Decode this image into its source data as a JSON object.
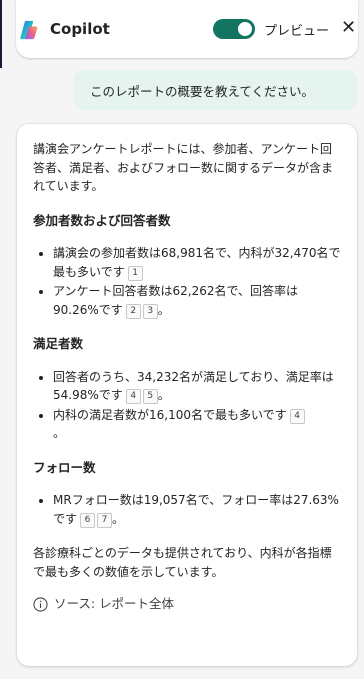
{
  "header": {
    "app_title": "Copilot",
    "toggle_label": "プレビュー",
    "toggle_on": true,
    "close_glyph": "✕",
    "accent_color": "#137462"
  },
  "user_message": "このレポートの概要を教えてください。",
  "response": {
    "intro": "講演会アンケートレポートには、参加者、アンケート回答者、満足者、およびフォロー数に関するデータが含まれています。",
    "sections": [
      {
        "heading": "参加者数および回答者数",
        "items": [
          {
            "text": "講演会の参加者数は68,981名で、内科が32,470名で最も多いです",
            "citations": [
              "1"
            ]
          },
          {
            "text": "アンケート回答者数は62,262名で、回答率は90.26%です",
            "citations": [
              "2",
              "3"
            ],
            "suffix": "。"
          }
        ]
      },
      {
        "heading": "満足者数",
        "items": [
          {
            "text": "回答者のうち、34,232名が満足しており、満足率は54.98%です",
            "citations": [
              "4",
              "5"
            ],
            "suffix": "。"
          },
          {
            "text": "内科の満足者数が16,100名で最も多いです",
            "citations": [
              "4"
            ],
            "suffix": "。"
          }
        ]
      },
      {
        "heading": "フォロー数",
        "items": [
          {
            "text": "MRフォロー数は19,057名で、フォロー率は27.63%です",
            "citations": [
              "6",
              "7"
            ],
            "suffix": "。"
          }
        ]
      }
    ],
    "closing": "各診療科ごとのデータも提供されており、内科が各指標で最も多くの数値を示しています。",
    "source_label": "ソース: レポート全体"
  }
}
